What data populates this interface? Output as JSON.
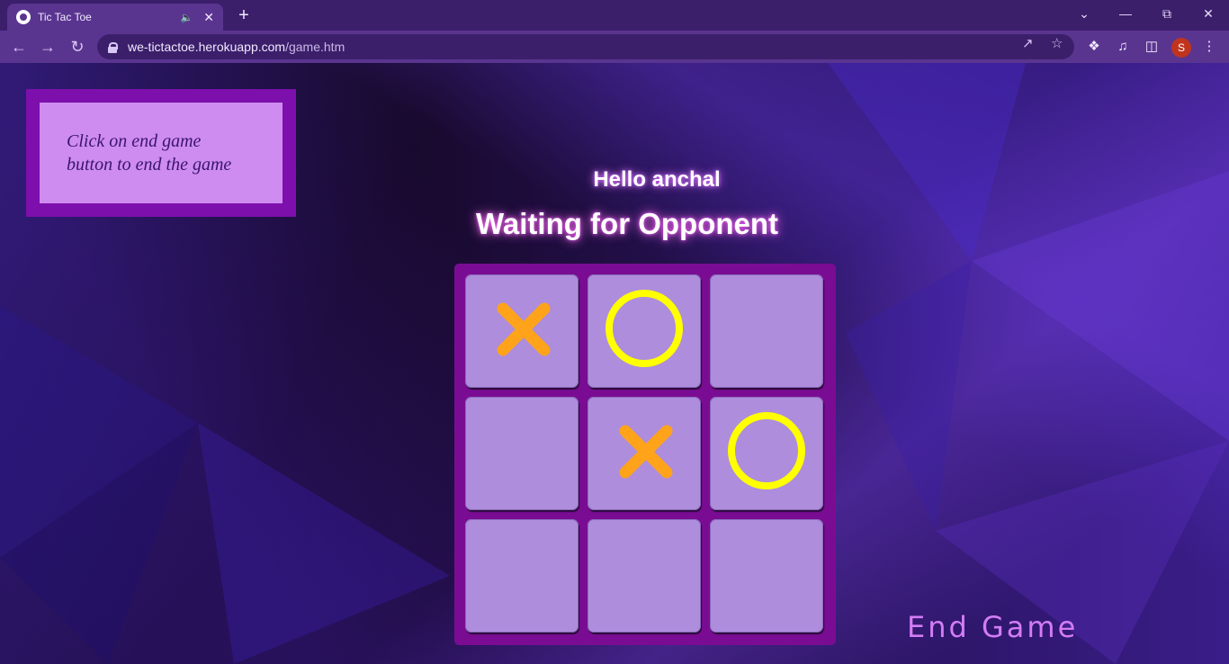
{
  "browser": {
    "tab_title": "Tic Tac Toe",
    "url_host": "we-tictactoe.herokuapp.com",
    "url_path": "/game.htm",
    "profile_initial": "S"
  },
  "hint": {
    "line1": "Click on end game",
    "line2": "button to end the game"
  },
  "greeting": "Hello anchal",
  "status": "Waiting for Opponent",
  "board": {
    "cells": [
      "X",
      "O",
      "",
      "",
      "X",
      "O",
      "",
      "",
      ""
    ]
  },
  "end_game_label": "End Game",
  "colors": {
    "x_mark": "#ffa31a",
    "o_mark": "#ffff00",
    "cell": "#ad8ddc",
    "board": "#7a0c93",
    "accent": "#d47cf5"
  }
}
